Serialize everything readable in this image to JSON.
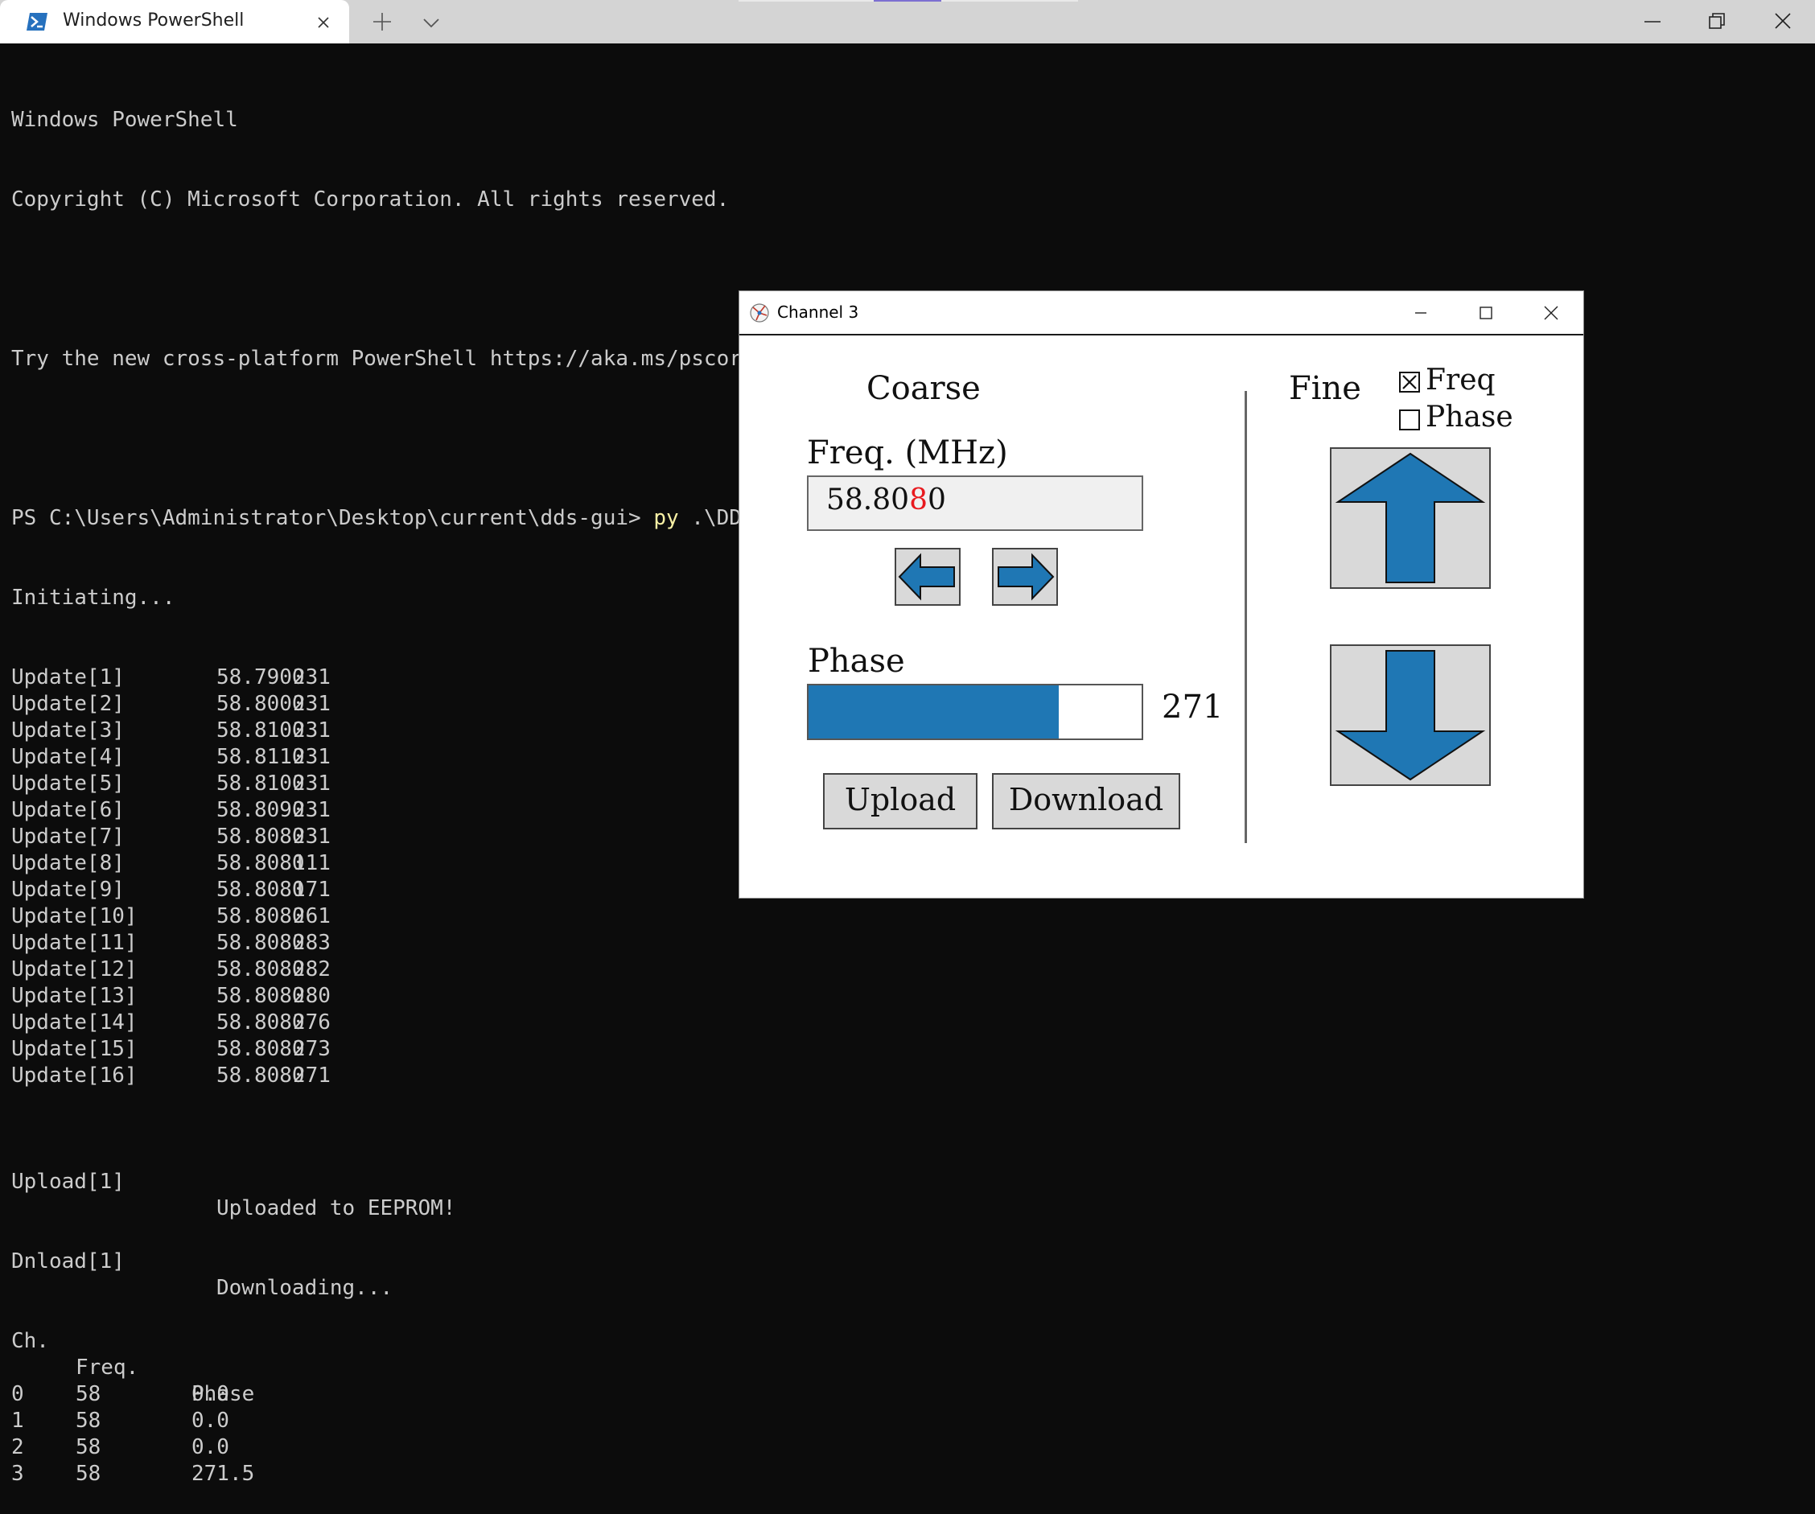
{
  "terminal_app": {
    "tab_title": "Windows PowerShell",
    "icons": {
      "tab": "powershell-icon",
      "close_tab": "close-icon",
      "new_tab": "plus-icon",
      "dropdown": "chevron-down-icon",
      "minimize": "minimize-icon",
      "restore": "restore-icon",
      "close": "close-icon"
    }
  },
  "terminal": {
    "header": [
      "Windows PowerShell",
      "Copyright (C) Microsoft Corporation. All rights reserved.",
      "",
      "Try the new cross-platform PowerShell https://aka.ms/pscore6",
      ""
    ],
    "prompt": "PS C:\\Users\\Administrator\\Desktop\\current\\dds-gui>",
    "command_name": "py",
    "command_args": ".\\DDS_ui_freq.py",
    "status": "Initiating...",
    "updates": [
      {
        "label": "Update[1]",
        "freq": "58.7900",
        "phase": "231"
      },
      {
        "label": "Update[2]",
        "freq": "58.8000",
        "phase": "231"
      },
      {
        "label": "Update[3]",
        "freq": "58.8100",
        "phase": "231"
      },
      {
        "label": "Update[4]",
        "freq": "58.8110",
        "phase": "231"
      },
      {
        "label": "Update[5]",
        "freq": "58.8100",
        "phase": "231"
      },
      {
        "label": "Update[6]",
        "freq": "58.8090",
        "phase": "231"
      },
      {
        "label": "Update[7]",
        "freq": "58.8080",
        "phase": "231"
      },
      {
        "label": "Update[8]",
        "freq": "58.8080",
        "phase": "111"
      },
      {
        "label": "Update[9]",
        "freq": "58.8080",
        "phase": "171"
      },
      {
        "label": "Update[10]",
        "freq": "58.8080",
        "phase": "261"
      },
      {
        "label": "Update[11]",
        "freq": "58.8080",
        "phase": "283"
      },
      {
        "label": "Update[12]",
        "freq": "58.8080",
        "phase": "282"
      },
      {
        "label": "Update[13]",
        "freq": "58.8080",
        "phase": "280"
      },
      {
        "label": "Update[14]",
        "freq": "58.8080",
        "phase": "276"
      },
      {
        "label": "Update[15]",
        "freq": "58.8080",
        "phase": "273"
      },
      {
        "label": "Update[16]",
        "freq": "58.8080",
        "phase": "271"
      }
    ],
    "upload": {
      "label": "Upload[1]",
      "message": "Uploaded to EEPROM!"
    },
    "download": {
      "label": "Dnload[1]",
      "message": "Downloading..."
    },
    "table": {
      "headers": [
        "Ch.",
        "Freq.",
        "Phase"
      ],
      "rows": [
        [
          "0",
          "58",
          "0.0"
        ],
        [
          "1",
          "58",
          "0.0"
        ],
        [
          "2",
          "58",
          "0.0"
        ],
        [
          "3",
          "58",
          "271.5"
        ]
      ]
    }
  },
  "channel_window": {
    "title": "Channel 3",
    "icons": {
      "app": "app-icon",
      "minimize": "minimize-icon",
      "maximize": "maximize-icon",
      "close": "close-icon",
      "left": "arrow-left-icon",
      "right": "arrow-right-icon",
      "up": "arrow-up-icon",
      "down": "arrow-down-icon"
    },
    "coarse_label": "Coarse",
    "fine_label": "Fine",
    "freq_label": "Freq. (MHz)",
    "freq_value_pre": "58.80",
    "freq_value_digit": "8",
    "freq_value_post": "0",
    "phase_label": "Phase",
    "phase_value": "271",
    "phase_fill_fraction": 0.75,
    "upload_label": "Upload",
    "download_label": "Download",
    "fine_freq_label": "Freq",
    "fine_freq_checked": true,
    "fine_phase_label": "Phase",
    "fine_phase_checked": false,
    "colors": {
      "accent_blue": "#1f77b4",
      "selected_digit": "#e8191e",
      "button_face": "#d9d9d9"
    }
  }
}
